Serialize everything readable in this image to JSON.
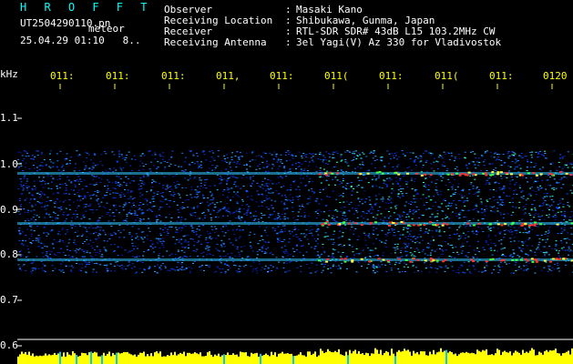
{
  "header": {
    "title": "H R O F F T",
    "file_name": "UT2504290110.pn",
    "file_suffix": "meteor",
    "date_time": "25.04.29 01:10",
    "date_extra": "8..",
    "fields": [
      {
        "label": "Observer",
        "value": "Masaki Kano"
      },
      {
        "label": "Receiving Location",
        "value": "Shibukawa, Gunma, Japan"
      },
      {
        "label": "Receiver",
        "value": "RTL-SDR SDR# 43dB L15 103.2MHz CW"
      },
      {
        "label": "Receiving Antenna",
        "value": "3el Yagi(V) Az 330 for Vladivostok"
      }
    ]
  },
  "spectrogram": {
    "y_unit": "kHz",
    "y_ticks": [
      "1.1",
      "1.0",
      "0.9",
      "0.8",
      "0.7",
      "0.6"
    ],
    "y_range": [
      0.6,
      1.15
    ],
    "x_ticks": [
      "011",
      "011",
      "011",
      "011",
      "011",
      "011",
      "011",
      "011",
      "011",
      "0120"
    ],
    "x_ticks_suffix": [
      ":",
      ":",
      ":",
      ",",
      ":",
      "(",
      ":",
      "(",
      ":",
      ""
    ],
    "signal_band_khz": [
      0.76,
      1.03
    ],
    "bright_lines_khz": [
      0.98,
      0.87,
      0.79
    ],
    "colors": {
      "background": "#000000",
      "axis": "#ffffff",
      "header_title": "#00ffff",
      "tick_label": "#ffff00",
      "noise_floor": "#ffff00",
      "noise_spike": "#00c8ff"
    }
  }
}
